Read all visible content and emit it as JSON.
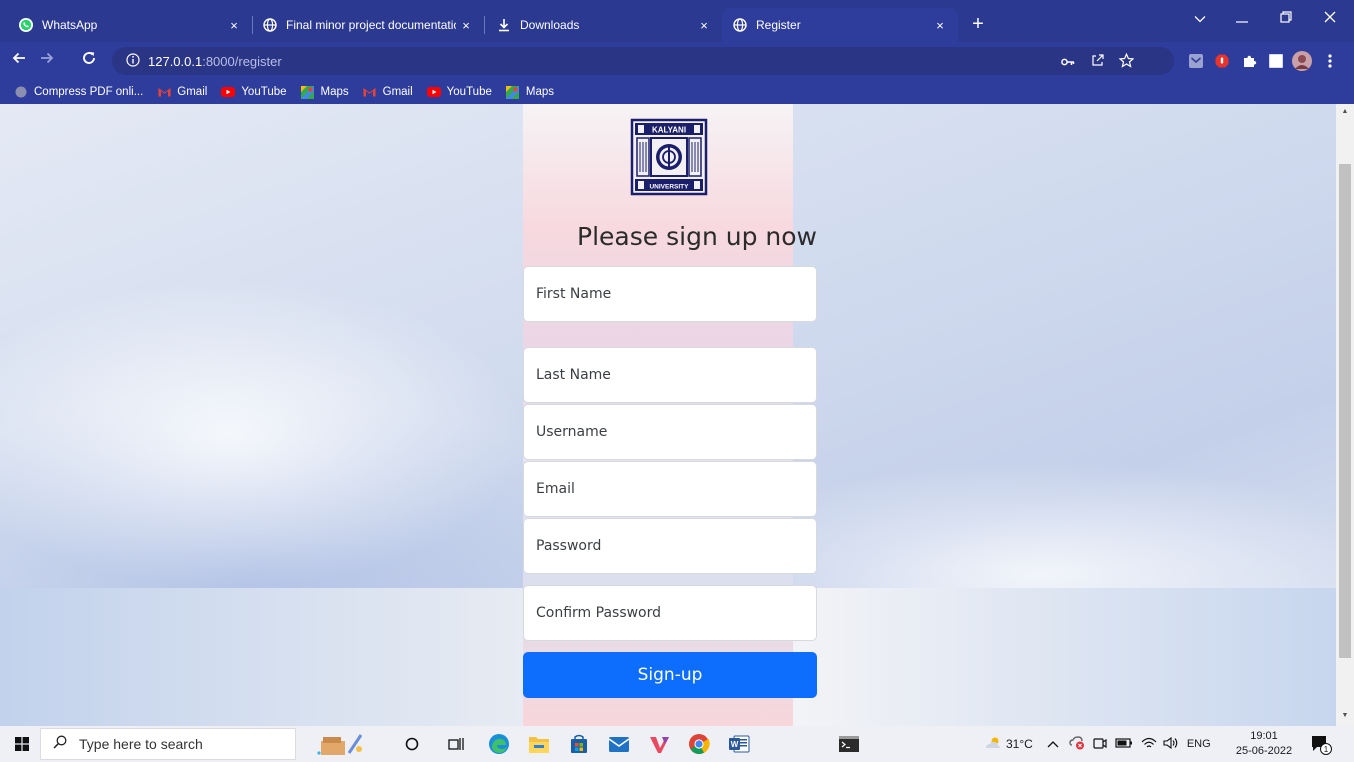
{
  "browser": {
    "tabs": [
      {
        "title": "WhatsApp",
        "icon": "whatsapp-icon"
      },
      {
        "title": "Final minor project documentatio",
        "icon": "globe-icon"
      },
      {
        "title": "Downloads",
        "icon": "download-icon"
      },
      {
        "title": "Register",
        "icon": "globe-icon",
        "active": true
      }
    ],
    "close_glyph": "×",
    "new_tab_glyph": "+",
    "url_host": "127.0.0.1",
    "url_rest": ":8000/register",
    "bookmarks": [
      {
        "label": "Compress PDF onli...",
        "icon": "compress-pdf-icon"
      },
      {
        "label": "Gmail",
        "icon": "gmail-icon"
      },
      {
        "label": "YouTube",
        "icon": "youtube-icon"
      },
      {
        "label": "Maps",
        "icon": "maps-icon"
      },
      {
        "label": "Gmail",
        "icon": "gmail-icon"
      },
      {
        "label": "YouTube",
        "icon": "youtube-icon"
      },
      {
        "label": "Maps",
        "icon": "maps-icon"
      }
    ]
  },
  "page": {
    "logo_text_top": "KALYANI",
    "logo_text_bottom": "UNIVERSITY",
    "heading": "Please sign up now",
    "fields": [
      {
        "placeholder": "First Name"
      },
      {
        "placeholder": "Last Name"
      },
      {
        "placeholder": "Username"
      },
      {
        "placeholder": "Email"
      },
      {
        "placeholder": "Password"
      },
      {
        "placeholder": "Confirm Password"
      }
    ],
    "submit_label": "Sign-up"
  },
  "taskbar": {
    "search_placeholder": "Type here to search",
    "weather": "31°C",
    "language": "ENG",
    "time": "19:01",
    "date": "25-06-2022",
    "notification_count": "1"
  },
  "colors": {
    "browser_frame": "#2b3990",
    "primary_button": "#0d6efd",
    "logo_ink": "#1b1f6b"
  }
}
